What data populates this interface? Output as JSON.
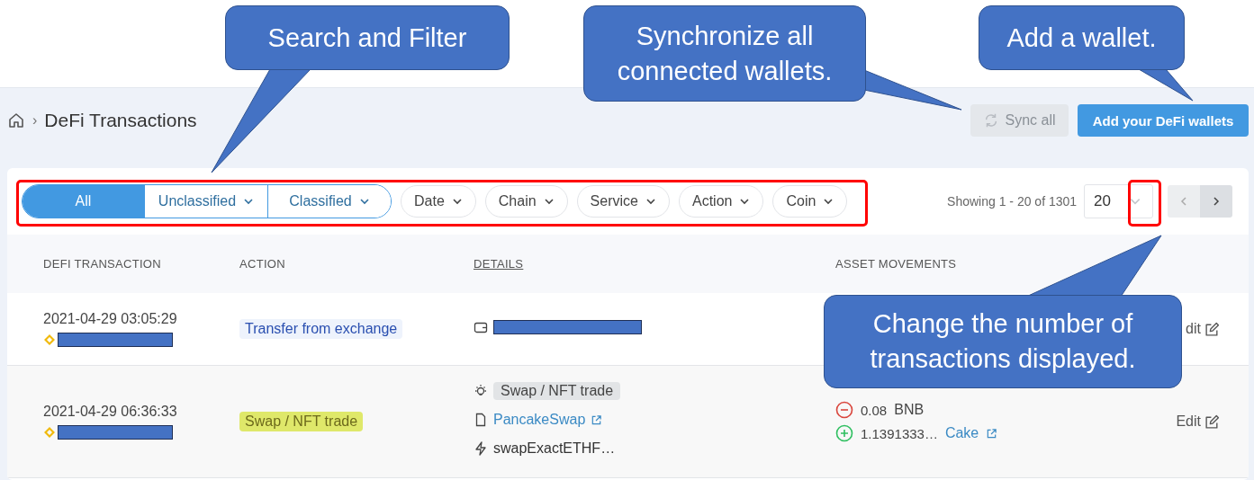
{
  "callouts": [
    {
      "text": "Search and Filter"
    },
    {
      "text": "Synchronize all connected wallets."
    },
    {
      "text": "Add a wallet."
    },
    {
      "text": "Change the number of transactions displayed."
    }
  ],
  "breadcrumb": {
    "separator": "›",
    "title": "DeFi Transactions"
  },
  "header_buttons": [
    {
      "label": "Sync all",
      "disabled": true
    },
    {
      "label": "Add your DeFi wallets",
      "disabled": false
    }
  ],
  "filters": {
    "segments": [
      {
        "label": "All",
        "selected": true,
        "dropdown": false
      },
      {
        "label": "Unclassified",
        "selected": false,
        "dropdown": true
      },
      {
        "label": "Classified",
        "selected": false,
        "dropdown": true
      }
    ],
    "pills": [
      "Date",
      "Chain",
      "Service",
      "Action",
      "Coin"
    ]
  },
  "pagination": {
    "summary": "Showing 1 - 20 of 1301",
    "page_size": "20"
  },
  "table": {
    "columns": [
      {
        "label": "DEFI TRANSACTION",
        "underlined": false
      },
      {
        "label": "ACTION",
        "underlined": false
      },
      {
        "label": "DETAILS",
        "underlined": true
      },
      {
        "label": "ASSET MOVEMENTS",
        "underlined": false
      }
    ],
    "rows": [
      {
        "time": "2021-04-29 03:05:29",
        "action": {
          "label": "Transfer from exchange",
          "color": "#eef3fc"
        },
        "details": [
          {
            "kind": "wallet"
          }
        ],
        "assets": [],
        "edit": "dit"
      },
      {
        "time": "2021-04-29 06:36:33",
        "action": {
          "label": "Swap / NFT trade",
          "color": "#dfe86a"
        },
        "details": [
          {
            "kind": "category",
            "text": "Swap / NFT trade"
          },
          {
            "kind": "service",
            "text": "PancakeSwap"
          },
          {
            "kind": "method",
            "text": "swapExactETHF…"
          }
        ],
        "assets": [
          {
            "kind": "outgoing",
            "amount": "0.08",
            "coin": "BNB",
            "link": false
          },
          {
            "kind": "incoming",
            "amount": "1.1391333…",
            "coin": "Cake",
            "link": true
          }
        ],
        "edit": "Edit"
      }
    ]
  }
}
